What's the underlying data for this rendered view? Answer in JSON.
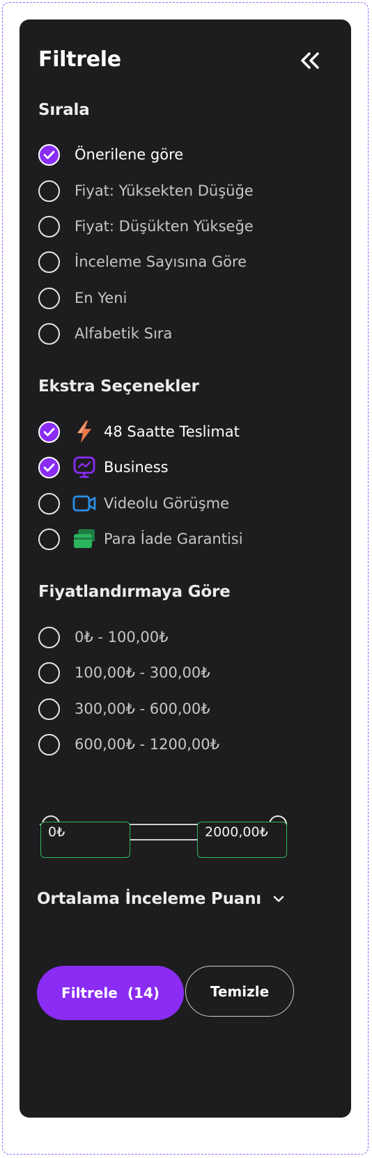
{
  "panel": {
    "title": "Filtrele",
    "collapse_icon": "double-chevron-left-icon"
  },
  "sort": {
    "title": "Sırala",
    "options": [
      {
        "label": "Önerilene göre",
        "checked": true
      },
      {
        "label": "Fiyat: Yüksekten Düşüğe",
        "checked": false
      },
      {
        "label": "Fiyat: Düşükten Yükseğe",
        "checked": false
      },
      {
        "label": "İnceleme Sayısına Göre",
        "checked": false
      },
      {
        "label": "En Yeni",
        "checked": false
      },
      {
        "label": "Alfabetik Sıra",
        "checked": false
      }
    ]
  },
  "extras": {
    "title": "Ekstra Seçenekler",
    "options": [
      {
        "label": "48 Saatte Teslimat",
        "checked": true,
        "icon": "lightning-icon",
        "icon_color": "#e8784a"
      },
      {
        "label": "Business",
        "checked": true,
        "icon": "presentation-icon",
        "icon_color": "#8a2cf3"
      },
      {
        "label": "Videolu Görüşme",
        "checked": false,
        "icon": "video-camera-icon",
        "icon_color": "#2b8fe6"
      },
      {
        "label": "Para İade Garantisi",
        "checked": false,
        "icon": "money-card-icon",
        "icon_color": "#2bb55d"
      }
    ]
  },
  "pricing": {
    "title": "Fiyatlandırmaya Göre",
    "options": [
      {
        "label": "0₺ - 100,00₺",
        "checked": false
      },
      {
        "label": "100,00₺ - 300,00₺",
        "checked": false
      },
      {
        "label": "300,00₺ - 600,00₺",
        "checked": false
      },
      {
        "label": "600,00₺ - 1200,00₺",
        "checked": false
      }
    ],
    "min_value": "0₺",
    "max_value": "2000,00₺"
  },
  "rating": {
    "title": "Ortalama İnceleme Puanı",
    "icon": "chevron-down-icon"
  },
  "actions": {
    "filter_label": "Filtrele",
    "filter_count": "(14)",
    "clear_label": "Temizle"
  },
  "colors": {
    "accent": "#8a2cf3",
    "panel_bg": "#1d1d1f",
    "input_border": "#2fb85b"
  }
}
